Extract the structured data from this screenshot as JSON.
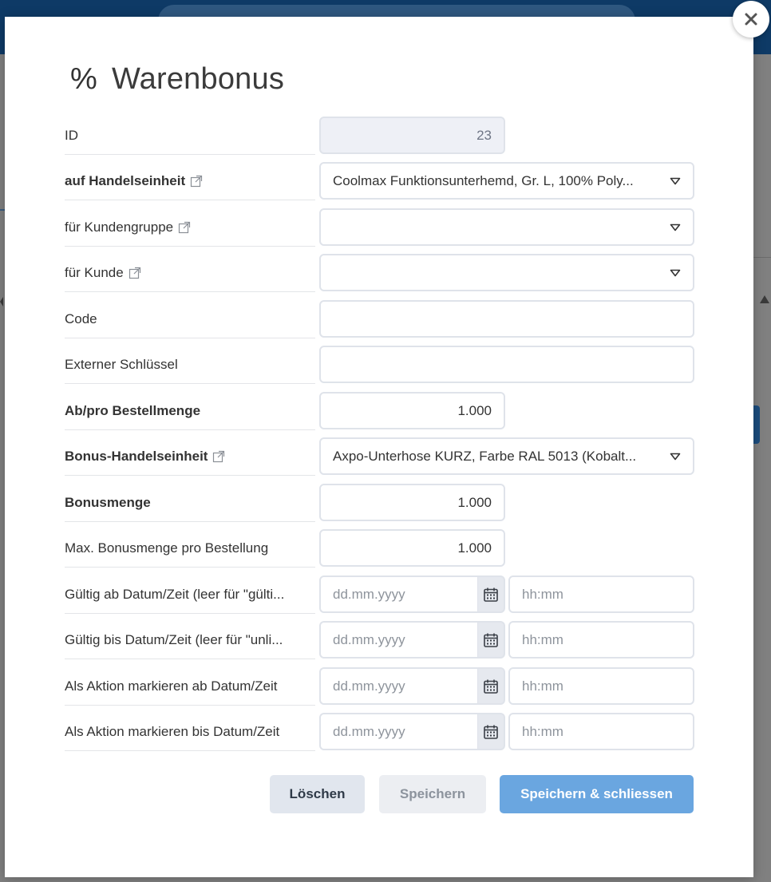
{
  "dialog": {
    "title_icon": "%",
    "title": "Warenbonus",
    "close_icon": "close-icon"
  },
  "fields": {
    "id": {
      "label": "ID",
      "value": "23"
    },
    "handelseinheit": {
      "label": "auf Handelseinheit",
      "value": "Coolmax Funktionsunterhemd, Gr. L, 100% Poly..."
    },
    "kundengruppe": {
      "label": "für Kundengruppe",
      "value": ""
    },
    "kunde": {
      "label": "für Kunde",
      "value": ""
    },
    "code": {
      "label": "Code",
      "value": ""
    },
    "externer_schluessel": {
      "label": "Externer Schlüssel",
      "value": ""
    },
    "bestellmenge": {
      "label": "Ab/pro Bestellmenge",
      "value": "1.000"
    },
    "bonus_handelseinheit": {
      "label": "Bonus-Handelseinheit",
      "value": "Axpo-Unterhose KURZ, Farbe RAL 5013 (Kobalt..."
    },
    "bonusmenge": {
      "label": "Bonusmenge",
      "value": "1.000"
    },
    "max_bonusmenge": {
      "label": "Max. Bonusmenge pro Bestellung",
      "value": "1.000"
    },
    "gueltig_ab": {
      "label": "Gültig ab Datum/Zeit (leer für \"gülti...",
      "date_placeholder": "dd.mm.yyyy",
      "time_placeholder": "hh:mm"
    },
    "gueltig_bis": {
      "label": "Gültig bis Datum/Zeit (leer für \"unli...",
      "date_placeholder": "dd.mm.yyyy",
      "time_placeholder": "hh:mm"
    },
    "aktion_ab": {
      "label": "Als Aktion markieren ab Datum/Zeit",
      "date_placeholder": "dd.mm.yyyy",
      "time_placeholder": "hh:mm"
    },
    "aktion_bis": {
      "label": "Als Aktion markieren bis Datum/Zeit",
      "date_placeholder": "dd.mm.yyyy",
      "time_placeholder": "hh:mm"
    }
  },
  "buttons": {
    "delete": "Löschen",
    "save": "Speichern",
    "save_close": "Speichern & schliessen"
  },
  "colors": {
    "primary": "#6aa6e0",
    "topbar": "#0e3a66",
    "field_border": "#dfe3ea",
    "disabled_bg": "#eef0f6"
  }
}
